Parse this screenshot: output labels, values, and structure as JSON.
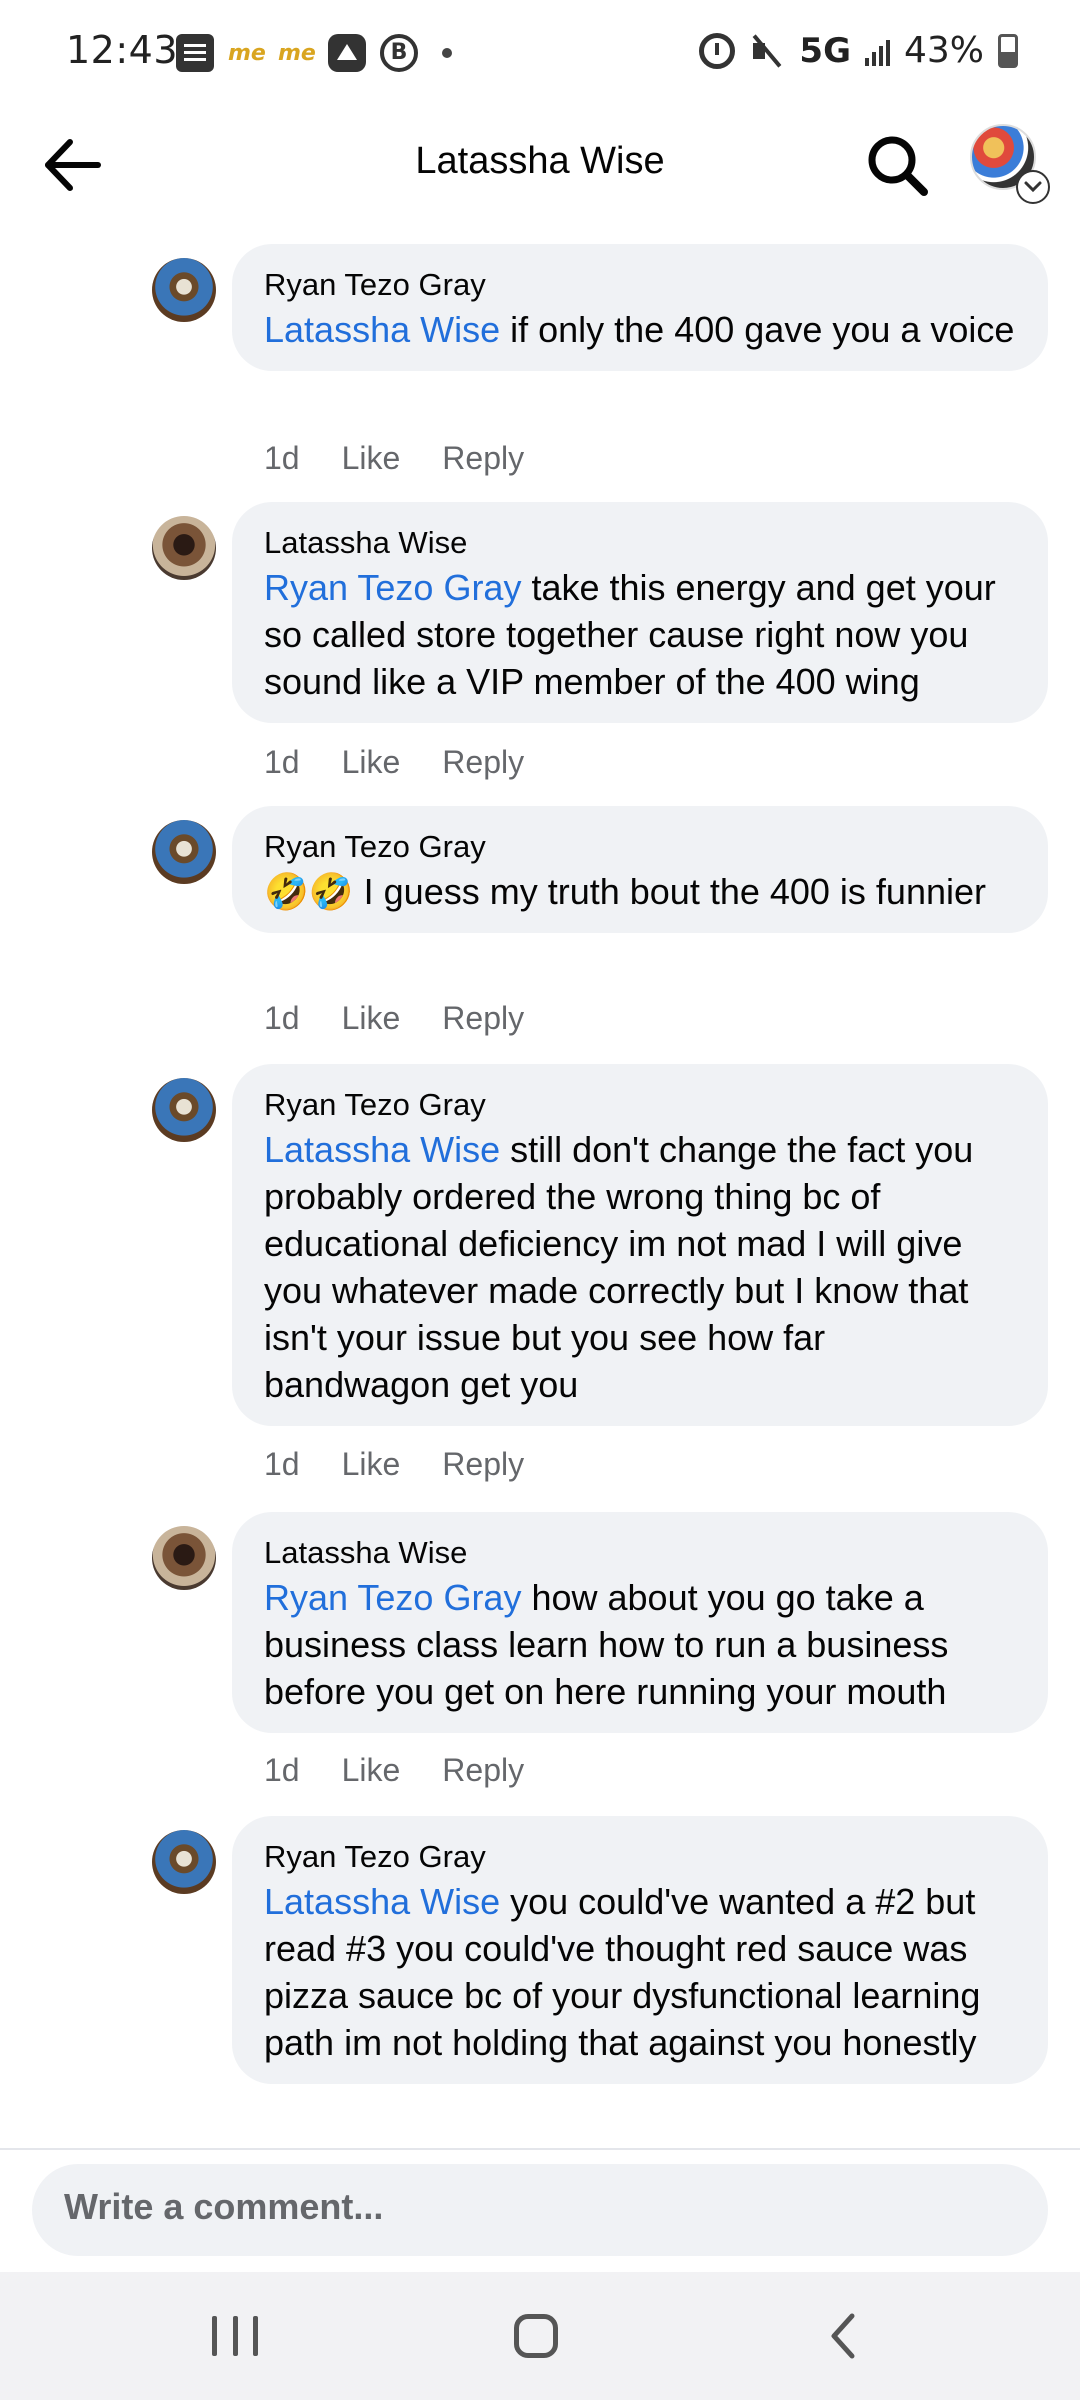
{
  "status_bar": {
    "time": "12:43",
    "left_icons": [
      "notes-icon",
      "me-icon",
      "me-icon",
      "app-icon",
      "b-icon",
      "dot-icon"
    ],
    "me_label": "me",
    "b_label": "B",
    "network": "5G",
    "battery": "43%"
  },
  "header": {
    "title": "Latassha Wise",
    "icons": [
      "back-arrow-icon",
      "search-icon",
      "profile-avatar",
      "chevron-down-icon"
    ]
  },
  "comments": [
    {
      "author": "Ryan Tezo Gray",
      "mention": "Latassha Wise",
      "text": " if only the 400 gave you a voice",
      "time": "1d",
      "like": "Like",
      "reply": "Reply"
    },
    {
      "author": "Latassha Wise",
      "mention": "Ryan Tezo Gray",
      "text": " take this energy and get your so called store together cause right now you sound like a VIP member of the 400 wing",
      "time": "1d",
      "like": "Like",
      "reply": "Reply"
    },
    {
      "author": "Ryan Tezo Gray",
      "mention": "",
      "text": "🤣🤣 I guess my truth bout the 400 is funnier",
      "time": "1d",
      "like": "Like",
      "reply": "Reply"
    },
    {
      "author": "Ryan Tezo Gray",
      "mention": "Latassha Wise",
      "text": " still don't change the fact you probably ordered the wrong thing bc of educational deficiency im not mad I will give you whatever made correctly but I know that isn't your issue but you see how far bandwagon get you",
      "time": "1d",
      "like": "Like",
      "reply": "Reply"
    },
    {
      "author": "Latassha Wise",
      "mention": "Ryan Tezo Gray",
      "text": " how about you go take a business class learn how to run a business before you get on here running your mouth",
      "time": "1d",
      "like": "Like",
      "reply": "Reply"
    },
    {
      "author": "Ryan Tezo Gray",
      "mention": "Latassha Wise",
      "text": " you could've wanted a #2 but read #3 you could've thought red sauce was pizza sauce bc of your dysfunctional learning path im not holding that against you honestly",
      "time": "",
      "like": "",
      "reply": ""
    }
  ],
  "composer": {
    "placeholder": "Write a comment..."
  },
  "navbar": {
    "icons": [
      "recents-icon",
      "home-icon",
      "back-icon"
    ]
  },
  "colors": {
    "mention": "#216fdb",
    "bubble": "#f0f2f5",
    "meta_text": "#65676b"
  }
}
